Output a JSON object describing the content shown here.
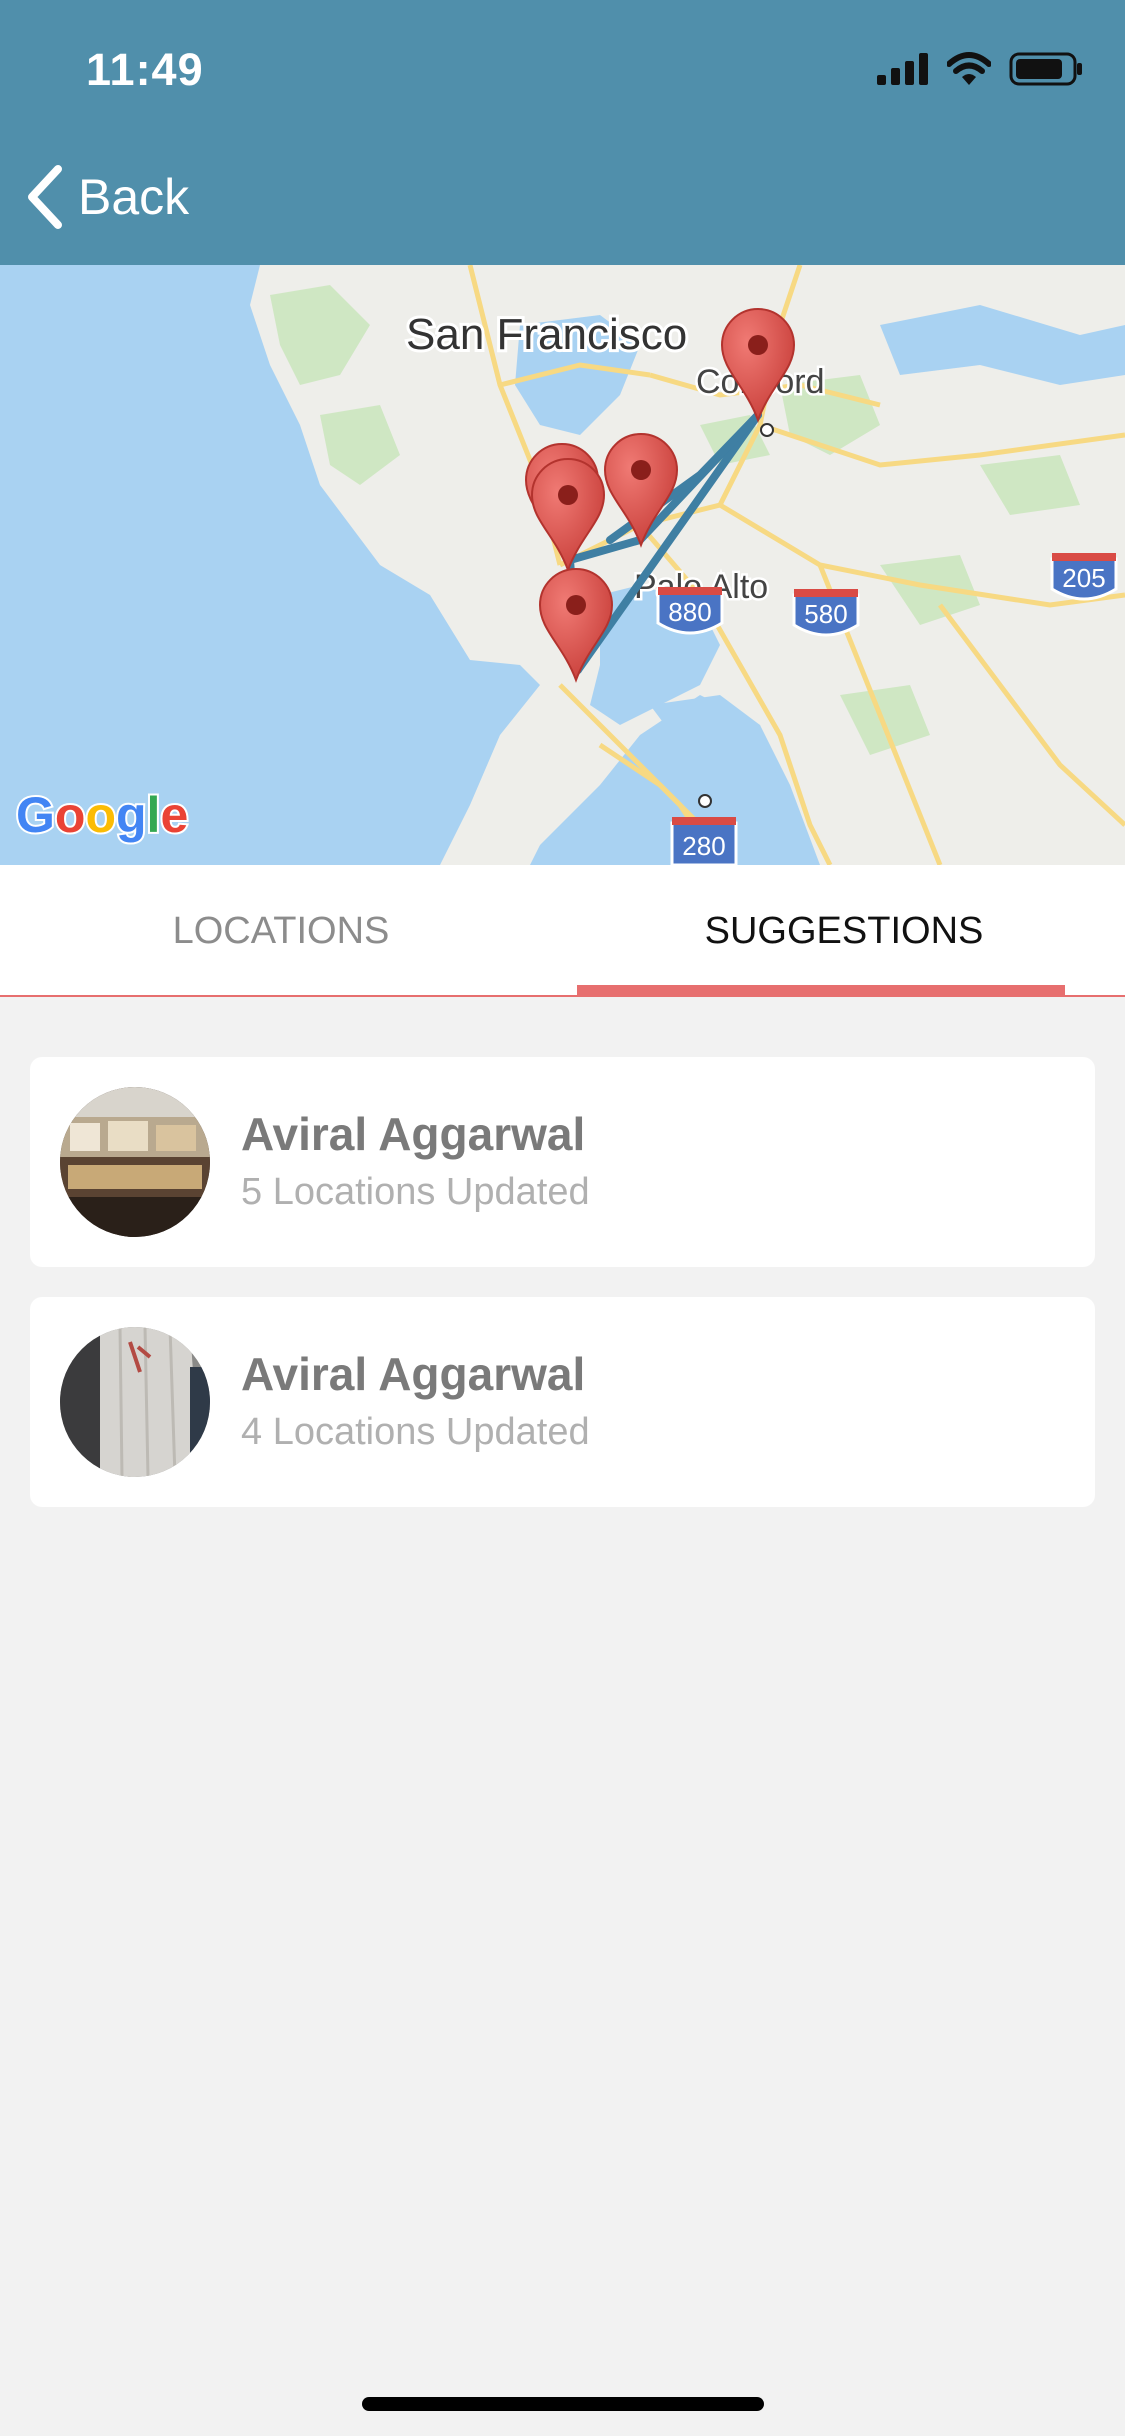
{
  "status_bar": {
    "time": "11:49",
    "icons": [
      "signal-icon",
      "wifi-icon",
      "battery-icon"
    ]
  },
  "nav": {
    "back_label": "Back",
    "back_icon": "chevron-left-icon"
  },
  "map": {
    "provider": "Google",
    "city_labels": [
      "San Francisco",
      "Concord",
      "Palo Alto"
    ],
    "highway_shields": [
      "880",
      "580",
      "205",
      "280"
    ],
    "pin_count": 5,
    "route_color": "#3f7fa3",
    "pin_color": "#e05a55"
  },
  "tabs": [
    {
      "label": "LOCATIONS",
      "active": false
    },
    {
      "label": "SUGGESTIONS",
      "active": true
    }
  ],
  "suggestions": [
    {
      "name": "Aviral Aggarwal",
      "subtitle": "5 Locations Updated"
    },
    {
      "name": "Aviral Aggarwal",
      "subtitle": "4 Locations Updated"
    }
  ],
  "colors": {
    "header": "#508fab",
    "accent": "#e76f6f",
    "background": "#f2f2f2"
  }
}
